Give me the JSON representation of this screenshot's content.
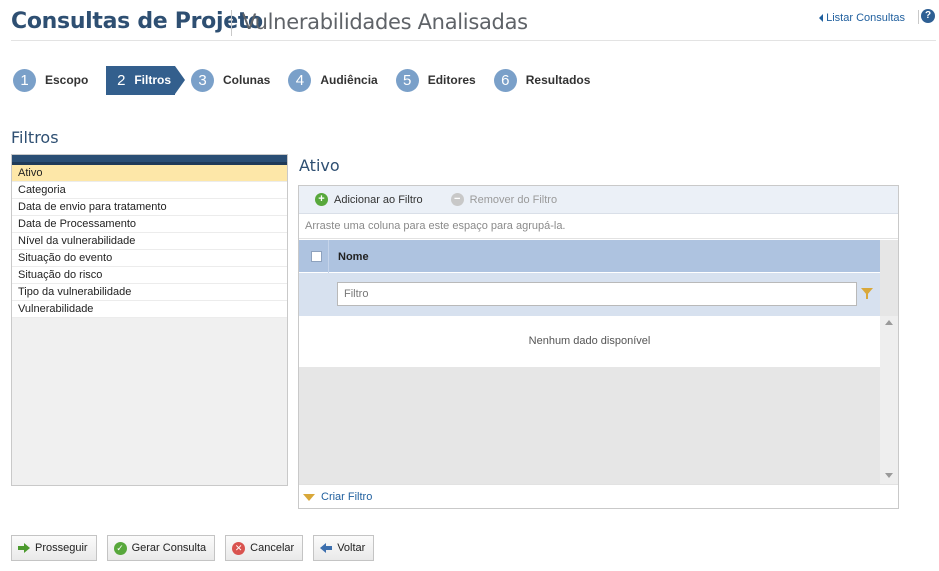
{
  "header": {
    "title": "Consultas de Projeto",
    "subtitle": "Vulnerabilidades Analisadas",
    "list_link": "Listar Consultas",
    "help_glyph": "?"
  },
  "steps": [
    {
      "num": "1",
      "label": "Escopo",
      "active": false
    },
    {
      "num": "2",
      "label": "Filtros",
      "active": true
    },
    {
      "num": "3",
      "label": "Colunas",
      "active": false
    },
    {
      "num": "4",
      "label": "Audiência",
      "active": false
    },
    {
      "num": "5",
      "label": "Editores",
      "active": false
    },
    {
      "num": "6",
      "label": "Resultados",
      "active": false
    }
  ],
  "filters_section": {
    "title": "Filtros",
    "items": [
      "Ativo",
      "Categoria",
      "Data de envio para tratamento",
      "Data de Processamento",
      "Nível da vulnerabilidade",
      "Situação do evento",
      "Situação do risco",
      "Tipo da vulnerabilidade",
      "Vulnerabilidade"
    ],
    "selected_index": 0
  },
  "panel": {
    "title": "Ativo",
    "toolbar": {
      "add_label": "Adicionar ao Filtro",
      "remove_label": "Remover do Filtro"
    },
    "group_hint": "Arraste uma coluna para este espaço para agrupá-la.",
    "column_header": "Nome",
    "filter_placeholder": "Filtro",
    "no_data": "Nenhum dado disponível",
    "create_filter": "Criar Filtro"
  },
  "buttons": {
    "proceed": "Prosseguir",
    "generate": "Gerar Consulta",
    "cancel": "Cancelar",
    "back": "Voltar"
  },
  "colors": {
    "brand": "#2e4f72",
    "active_step": "#335f8d",
    "step_circle": "#7aa0c9",
    "selected_row": "#fde7a8",
    "column_header": "#aec3e0"
  }
}
